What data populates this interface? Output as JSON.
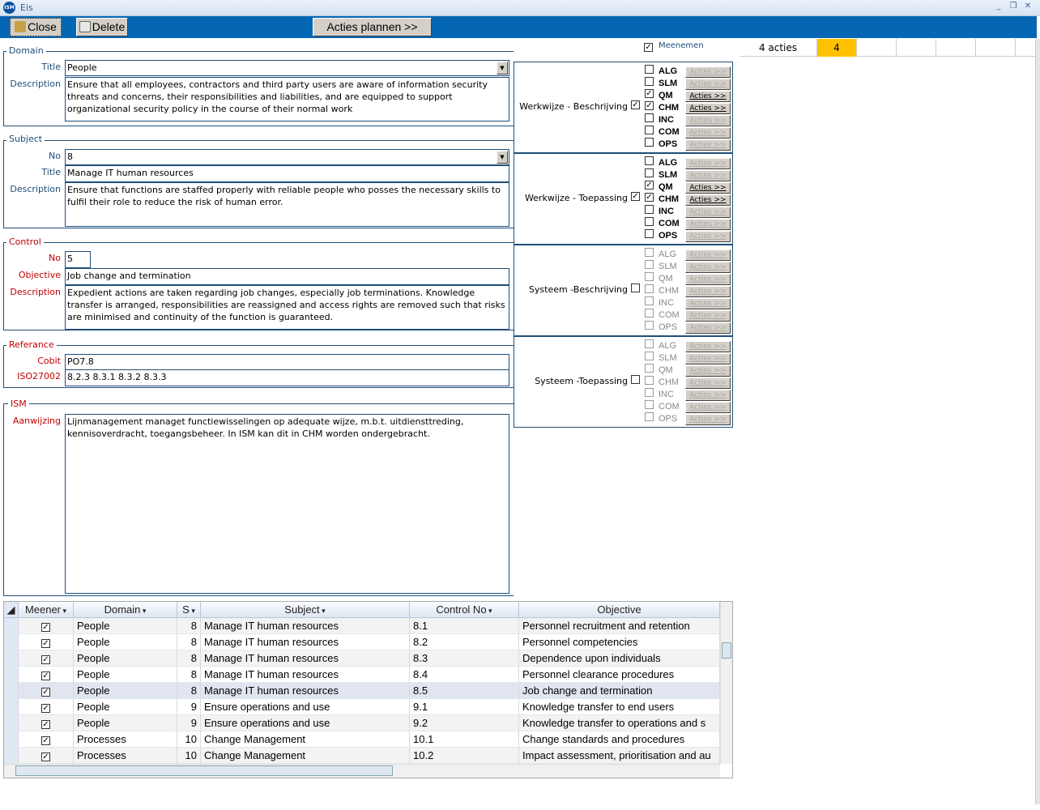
{
  "window": {
    "title": "Eis",
    "logo": "ISM"
  },
  "toolbar": {
    "close": "Close",
    "delete": "Delete",
    "plan": "Acties plannen >>"
  },
  "domain": {
    "legend": "Domain",
    "title_label": "Title",
    "title": "People",
    "desc_label": "Description",
    "description": "Ensure that all employees, contractors and third party users are aware of information security threats and concerns, their responsibilities and liabilities, and are equipped to support organizational security policy in the course of their normal work"
  },
  "subject": {
    "legend": "Subject",
    "no_label": "No",
    "no": "8",
    "title_label": "Title",
    "title": "Manage IT human resources",
    "desc_label": "Description",
    "description": "Ensure that functions are staffed properly with reliable people who posses the necessary skills to fulfil their role to reduce the risk of human error."
  },
  "control": {
    "legend": "Control",
    "no_label": "No",
    "no": "5",
    "objective_label": "Objective",
    "objective": "Job change and termination",
    "desc_label": "Description",
    "description": "Expedient actions are taken regarding job changes, especially job terminations. Knowledge transfer is arranged, responsibilities are reassigned and access rights are removed such that risks are minimised and continuity of the function is guaranteed."
  },
  "reference": {
    "legend": "Referance",
    "cobit_label": "Cobit",
    "cobit": "PO7.8",
    "iso_label": "ISO27002",
    "iso": "8.2.3  8.3.1  8.3.2  8.3.3"
  },
  "ism": {
    "legend": "ISM",
    "label": "Aanwijzing",
    "text": "Lijnmanagement managet functiewisselingen op adequate wijze, m.b.t. uitdiensttreding, kennisoverdracht, toegangsbeheer. In ISM kan dit in CHM worden ondergebracht."
  },
  "meenemen": {
    "label": "Meenemen",
    "checked": true
  },
  "actions_strip": {
    "label": "4 acties",
    "count": "4",
    "accent": "#ffc000"
  },
  "action_button_label": "Acties >>",
  "groups": [
    {
      "label": "Werkwijze - Beschrijving",
      "checked": true,
      "enabled": true,
      "items": [
        {
          "code": "ALG",
          "checked": false
        },
        {
          "code": "SLM",
          "checked": false
        },
        {
          "code": "QM",
          "checked": true
        },
        {
          "code": "CHM",
          "checked": true
        },
        {
          "code": "INC",
          "checked": false
        },
        {
          "code": "COM",
          "checked": false
        },
        {
          "code": "OPS",
          "checked": false
        }
      ]
    },
    {
      "label": "Werkwijze - Toepassing",
      "checked": true,
      "enabled": true,
      "items": [
        {
          "code": "ALG",
          "checked": false
        },
        {
          "code": "SLM",
          "checked": false
        },
        {
          "code": "QM",
          "checked": true
        },
        {
          "code": "CHM",
          "checked": true
        },
        {
          "code": "INC",
          "checked": false
        },
        {
          "code": "COM",
          "checked": false
        },
        {
          "code": "OPS",
          "checked": false
        }
      ]
    },
    {
      "label": "Systeem -Beschrijving",
      "checked": false,
      "enabled": false,
      "items": [
        {
          "code": "ALG",
          "checked": false
        },
        {
          "code": "SLM",
          "checked": false
        },
        {
          "code": "QM",
          "checked": false
        },
        {
          "code": "CHM",
          "checked": false
        },
        {
          "code": "INC",
          "checked": false
        },
        {
          "code": "COM",
          "checked": false
        },
        {
          "code": "OPS",
          "checked": false
        }
      ]
    },
    {
      "label": "Systeem -Toepassing",
      "checked": false,
      "enabled": false,
      "items": [
        {
          "code": "ALG",
          "checked": false
        },
        {
          "code": "SLM",
          "checked": false
        },
        {
          "code": "QM",
          "checked": false
        },
        {
          "code": "CHM",
          "checked": false
        },
        {
          "code": "INC",
          "checked": false
        },
        {
          "code": "COM",
          "checked": false
        },
        {
          "code": "OPS",
          "checked": false
        }
      ]
    }
  ],
  "grid": {
    "columns": [
      "Meener",
      "Domain",
      "S",
      "Subject",
      "Control No",
      "Objective"
    ],
    "rows": [
      {
        "meener": true,
        "domain": "People",
        "s": "8",
        "subject": "Manage IT human resources",
        "control": "8.1",
        "objective": "Personnel recruitment and retention"
      },
      {
        "meener": true,
        "domain": "People",
        "s": "8",
        "subject": "Manage IT human resources",
        "control": "8.2",
        "objective": "Personnel competencies"
      },
      {
        "meener": true,
        "domain": "People",
        "s": "8",
        "subject": "Manage IT human resources",
        "control": "8.3",
        "objective": "Dependence upon individuals"
      },
      {
        "meener": true,
        "domain": "People",
        "s": "8",
        "subject": "Manage IT human resources",
        "control": "8.4",
        "objective": "Personnel clearance procedures"
      },
      {
        "meener": true,
        "domain": "People",
        "s": "8",
        "subject": "Manage IT human resources",
        "control": "8.5",
        "objective": "Job change and termination",
        "selected": true
      },
      {
        "meener": true,
        "domain": "People",
        "s": "9",
        "subject": "Ensure operations and use",
        "control": "9.1",
        "objective": "Knowledge transfer to end users"
      },
      {
        "meener": true,
        "domain": "People",
        "s": "9",
        "subject": "Ensure operations and use",
        "control": "9.2",
        "objective": "Knowledge transfer to operations and s"
      },
      {
        "meener": true,
        "domain": "Processes",
        "s": "10",
        "subject": "Change Management",
        "control": "10.1",
        "objective": "Change standards and procedures"
      },
      {
        "meener": true,
        "domain": "Processes",
        "s": "10",
        "subject": "Change Management",
        "control": "10.2",
        "objective": "Impact assessment, prioritisation and au"
      }
    ]
  }
}
